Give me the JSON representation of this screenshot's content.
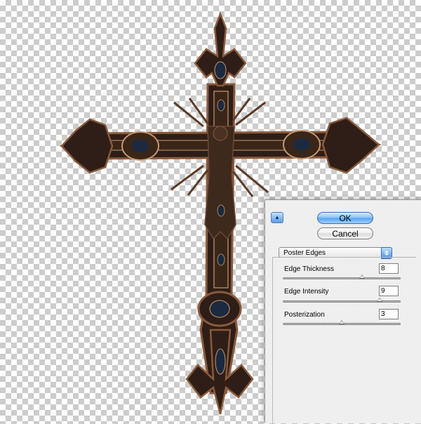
{
  "dialog": {
    "ok_label": "OK",
    "cancel_label": "Cancel",
    "filter_name": "Poster Edges",
    "params": [
      {
        "label": "Edge Thickness",
        "value": "8",
        "slider_fraction": 0.67
      },
      {
        "label": "Edge Intensity",
        "value": "9",
        "slider_fraction": 0.82
      },
      {
        "label": "Posterization",
        "value": "3",
        "slider_fraction": 0.5
      }
    ]
  },
  "icons": {
    "collapse": "triangle-up-icon",
    "popup": "up-down-arrows-icon"
  },
  "colors": {
    "cross_fill": "#2e1e17",
    "cross_bronze": "#8a5a3c",
    "cross_highlight": "#c89870",
    "cross_gem": "#1b2a40"
  }
}
